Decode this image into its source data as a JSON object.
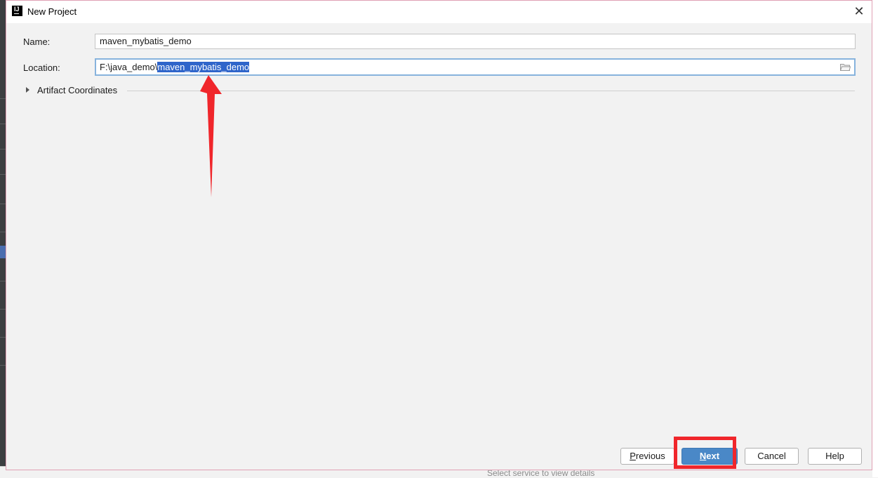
{
  "window": {
    "title": "New Project",
    "app_icon_text": "IJ",
    "close_symbol": "✕"
  },
  "form": {
    "name_label": "Name:",
    "name_value": "maven_mybatis_demo",
    "location_label": "Location:",
    "location_prefix": "F:\\java_demo\\",
    "location_selected": "maven_mybatis_demo",
    "artifact_section_label": "Artifact Coordinates"
  },
  "buttons": {
    "previous_first": "P",
    "previous_rest": "revious",
    "next_first": "N",
    "next_rest": "ext",
    "cancel": "Cancel",
    "help": "Help"
  },
  "background": {
    "bottom_hint": "Select service to view details"
  },
  "annotations": {
    "arrow_color": "#f0262b",
    "highlight_color": "#f0262b"
  },
  "icons": [
    "app-logo-icon",
    "close-icon",
    "folder-icon",
    "expand-triangle-icon"
  ]
}
